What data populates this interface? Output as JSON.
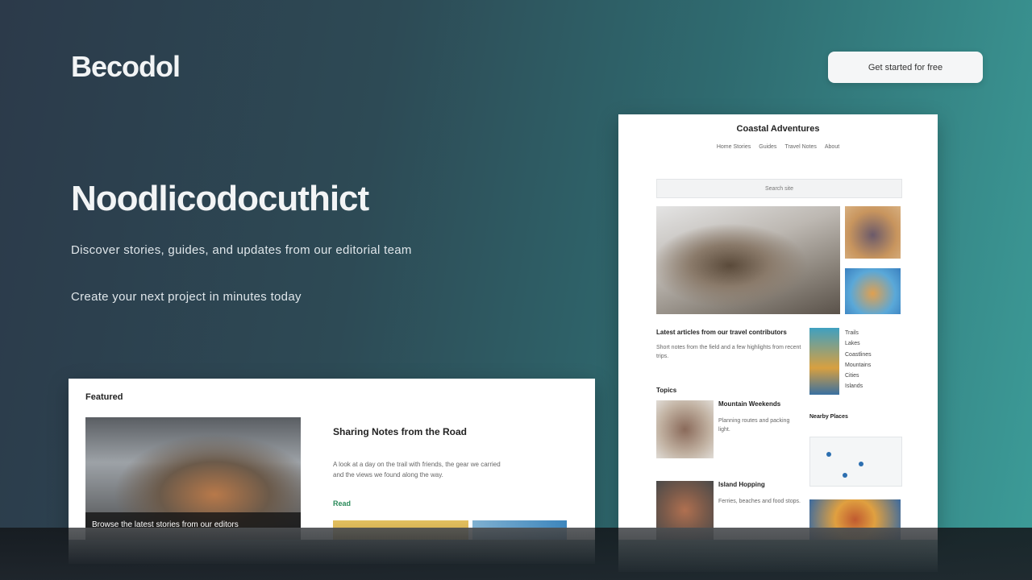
{
  "header": {
    "logo": "Becodol",
    "button_label": "Get started for free"
  },
  "hero": {
    "title": "Noodlicodocuthict",
    "subtitle": "Discover stories, guides, and updates from our editorial team",
    "subtitle2": "Create your next project in minutes today"
  },
  "front_card": {
    "label": "Featured",
    "caption": "Browse the latest stories from our editors",
    "headline": "Sharing Notes from the Road",
    "text": "A look at a day on the trail with friends, the gear we carried and the views we found along the way.",
    "tag": "Read"
  },
  "right_card": {
    "title": "Coastal Adventures",
    "nav": [
      "Home Stories",
      "Guides",
      "Travel Notes",
      "About"
    ],
    "search_placeholder": "Search site",
    "article_heading": "Latest articles from our travel contributors",
    "article_body": "Short notes from the field and a few highlights from recent trips.",
    "side_list": [
      "Trails",
      "Lakes",
      "Coastlines",
      "Mountains",
      "Cities",
      "Islands"
    ],
    "section_title": "Topics",
    "item1_title": "Mountain Weekends",
    "item1_text": "Planning routes and packing light.",
    "item2_title": "Island Hopping",
    "item2_text": "Ferries, beaches and food stops.",
    "widget_title": "Nearby Places"
  }
}
